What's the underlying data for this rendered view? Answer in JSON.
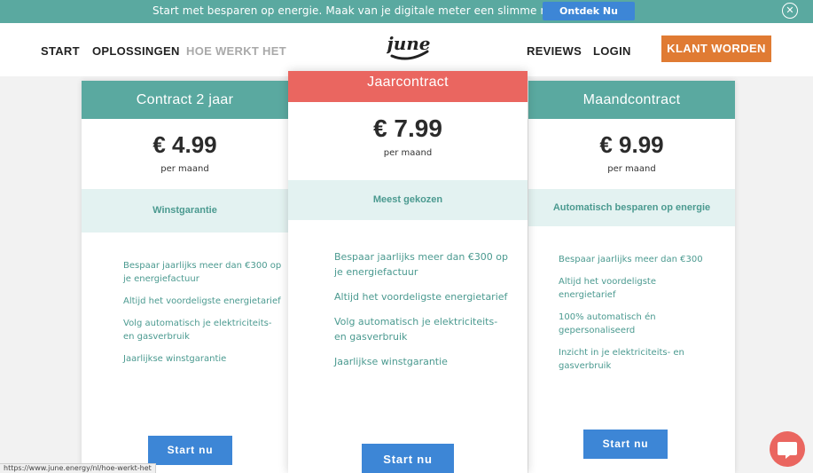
{
  "announcement": {
    "text": "Start met besparen op energie. Maak van je digitale meter een slimme meter.",
    "button_label": "Ontdek Nu",
    "close_icon": "close-circle-icon"
  },
  "nav": {
    "items": [
      "START",
      "OPLOSSINGEN",
      "HOE WERKT HET",
      "REVIEWS",
      "LOGIN"
    ],
    "logo_text": "june",
    "cta_label": "KLANT WORDEN"
  },
  "plans": [
    {
      "title": "Contract 2 jaar",
      "price": "€ 4.99",
      "period": "per maand",
      "highlight": "Winstgarantie",
      "features": [
        "Bespaar jaarlijks meer dan €300 op je energiefactuur",
        "Altijd het voordeligste energietarief",
        "Volg automatisch je elektriciteits- en gasverbruik",
        "Jaarlijkse winstgarantie"
      ],
      "button_label": "Start nu"
    },
    {
      "title": "Jaarcontract",
      "price": "€ 7.99",
      "period": "per maand",
      "highlight": "Meest gekozen",
      "features": [
        "Bespaar jaarlijks meer dan €300 op je energiefactuur",
        "Altijd het voordeligste energietarief",
        "Volg automatisch je elektriciteits- en gasverbruik",
        "Jaarlijkse winstgarantie"
      ],
      "button_label": "Start nu"
    },
    {
      "title": "Maandcontract",
      "price": "€ 9.99",
      "period": "per maand",
      "highlight": "Automatisch besparen op energie",
      "features": [
        "Bespaar jaarlijks meer dan €300",
        "Altijd het voordeligste energietarief",
        "100% automatisch én gepersonaliseerd",
        "Inzicht in je elektriciteits- en gasverbruik"
      ],
      "button_label": "Start nu"
    }
  ],
  "chat_icon": "chat-bubble-icon",
  "status_url": "https://www.june.energy/nl/hoe-werkt-het",
  "colors": {
    "teal": "#5aa9a0",
    "teal_light": "#e3f2f1",
    "coral": "#ea6660",
    "blue": "#3d86d6",
    "orange": "#e07b33"
  }
}
